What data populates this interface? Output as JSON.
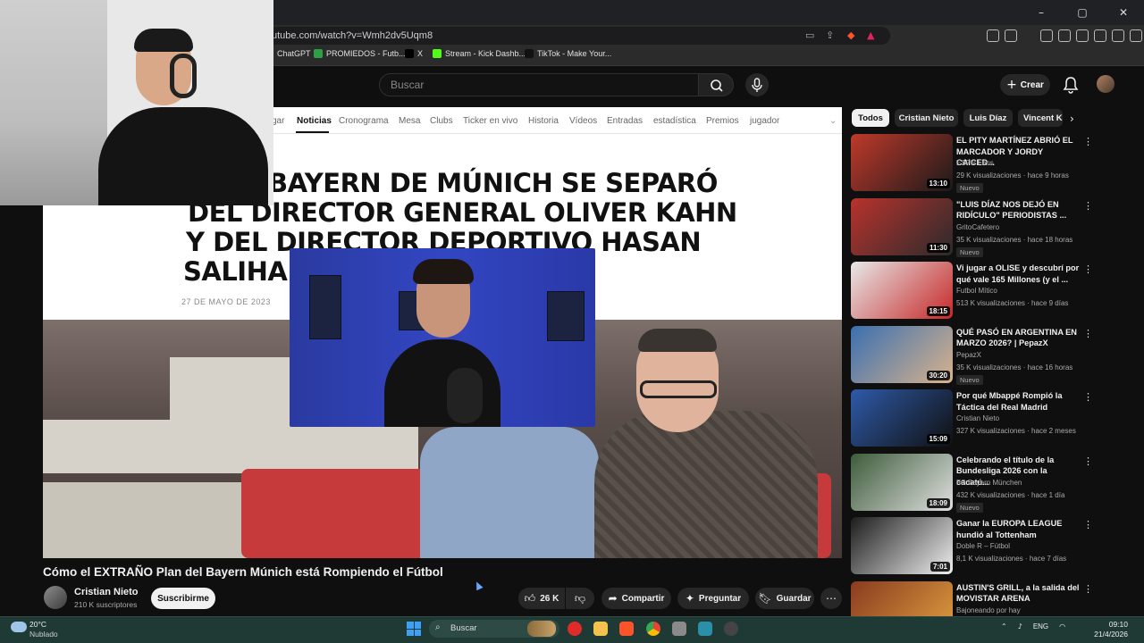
{
  "browser": {
    "url": "utube.com/watch?v=Wmh2dv5Uqm8",
    "window_controls": [
      "–",
      "▢",
      "✕"
    ],
    "bookmarks": [
      {
        "label": "ChatGPT",
        "color": "#444444"
      },
      {
        "label": "PROMIEDOS - Futb...",
        "color": "#2ea043"
      },
      {
        "label": "X",
        "color": "#000000"
      },
      {
        "label": "Stream - Kick Dashb...",
        "color": "#53fc18"
      },
      {
        "label": "TikTok - Make Your...",
        "color": "#111111"
      }
    ]
  },
  "youtube": {
    "search_placeholder": "Buscar",
    "create_label": "Crear"
  },
  "site_nav": {
    "tabs": [
      "gar",
      "Noticias",
      "Cronograma",
      "Mesa",
      "Clubs",
      "Ticker en vivo",
      "Historia",
      "Vídeos",
      "Entradas",
      "estadística",
      "Premios",
      "jugador"
    ],
    "active": "Noticias"
  },
  "article": {
    "headline_lines": [
      "BAYERN DE MÚNICH SE SEPARÓ",
      "DEL DIRECTOR GENERAL OLIVER KAHN",
      "Y DEL DIRECTOR DEPORTIVO HASAN",
      "SALIHAM"
    ],
    "date": "27 DE MAYO DE 2023"
  },
  "video": {
    "title": "Cómo el EXTRAÑO Plan del Bayern Múnich está Rompiendo el Fútbol",
    "channel": "Cristian Nieto",
    "subscribers": "210 K suscriptores",
    "subscribe_label": "Suscribirme",
    "likes": "26 K",
    "share_label": "Compartir",
    "ask_label": "Preguntar",
    "save_label": "Guardar"
  },
  "sidebar": {
    "chips": [
      "Todos",
      "Cristian Nieto",
      "Luis Díaz",
      "Vincent K"
    ],
    "recommendations": [
      {
        "title": "EL PITY MARTÍNEZ ABRIÓ EL MARCADOR Y JORDY CAICED...",
        "channel": "ESPN Fans",
        "meta": "29 K visualizaciones · hace 9 horas",
        "badge": "Nuevo",
        "duration": "13:10",
        "colors": [
          "#c0392b",
          "#1a1a1a"
        ]
      },
      {
        "title": "\"LUIS DÍAZ NOS DEJÓ EN RIDÍCULO\" PERIODISTAS ...",
        "channel": "GritoCafetero",
        "meta": "35 K visualizaciones · hace 18 horas",
        "badge": "Nuevo",
        "duration": "11:30",
        "colors": [
          "#b8322d",
          "#2b2b2b"
        ]
      },
      {
        "title": "Vi jugar a OLISE y descubrí por qué vale 165 Millones (y el ...",
        "channel": "Futbol Mítico",
        "meta": "513 K visualizaciones · hace 9 días",
        "badge": "",
        "duration": "18:15",
        "colors": [
          "#e8e8e8",
          "#c62828"
        ]
      },
      {
        "title": "QUÉ PASÓ EN ARGENTINA EN MARZO 2026? | PepazX",
        "channel": "PepazX",
        "meta": "35 K visualizaciones · hace 16 horas",
        "badge": "Nuevo",
        "duration": "30:20",
        "colors": [
          "#3a6fb0",
          "#d9b38c"
        ]
      },
      {
        "title": "Por qué Mbappé Rompió la Táctica del Real Madrid",
        "channel": "Cristian Nieto",
        "meta": "327 K visualizaciones · hace 2 meses",
        "badge": "",
        "duration": "15:09",
        "colors": [
          "#2e5aa8",
          "#101010"
        ]
      },
      {
        "title": "Celebrando el título de la Bundesliga 2026 con la cacatú...",
        "channel": "FC Bayern München",
        "meta": "432 K visualizaciones · hace 1 día",
        "badge": "Nuevo",
        "duration": "18:09",
        "colors": [
          "#3d5c3a",
          "#e0e0e0"
        ]
      },
      {
        "title": "Ganar la EUROPA LEAGUE hundió al Tottenham",
        "channel": "Doble R – Fútbol",
        "meta": "8,1 K visualizaciones · hace 7 días",
        "badge": "",
        "duration": "7:01",
        "colors": [
          "#1c1c1c",
          "#f0f0f0"
        ]
      },
      {
        "title": "AUSTIN'S GRILL, a la salida del MOVISTAR ARENA",
        "channel": "Bajoneando por hay",
        "meta": "",
        "badge": "",
        "duration": "",
        "colors": [
          "#8a3b1f",
          "#e0a040"
        ]
      }
    ]
  },
  "taskbar": {
    "temp": "20°C",
    "weather": "Nublado",
    "search": "Buscar",
    "lang": "ENG",
    "time": "09:10",
    "date": "21/4/2026"
  }
}
